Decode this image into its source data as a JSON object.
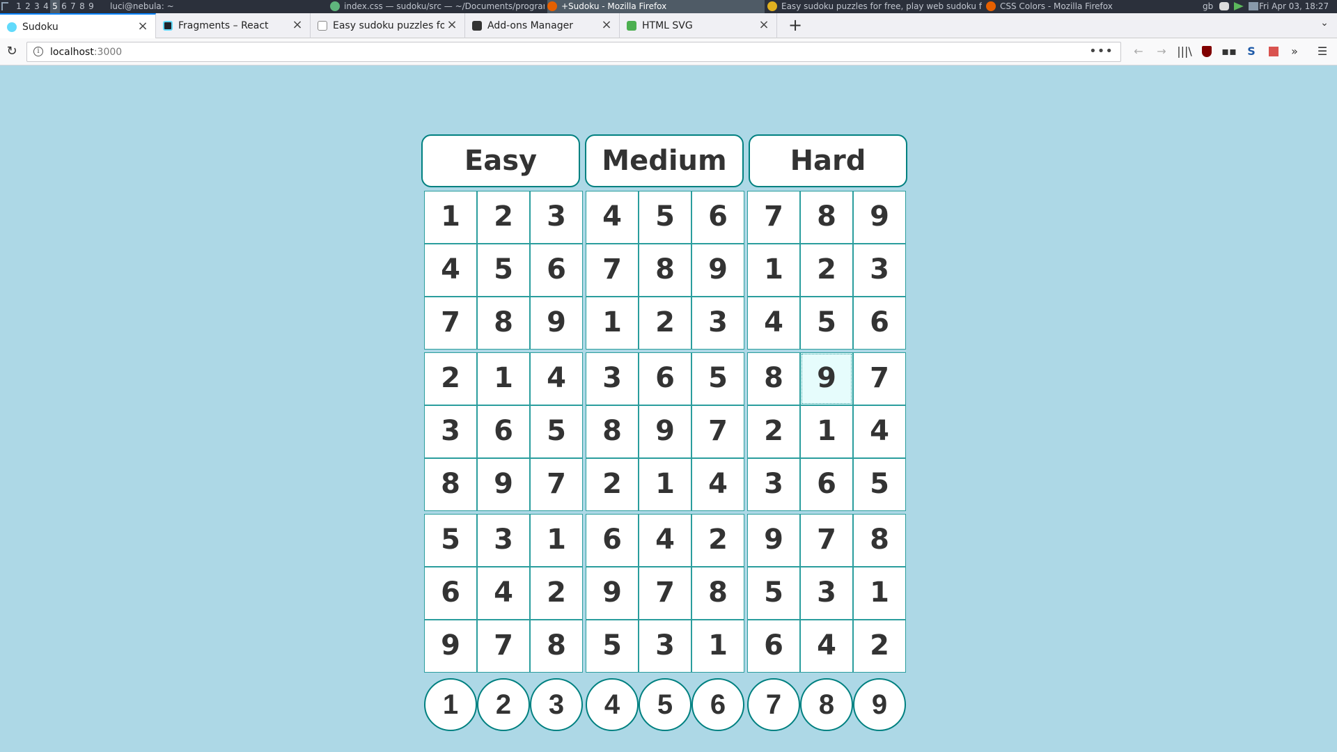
{
  "system_bar": {
    "workspaces": [
      "1",
      "2",
      "3",
      "4",
      "5",
      "6",
      "7",
      "8",
      "9"
    ],
    "active_workspace": "5",
    "windows": [
      {
        "title": "luci@nebula: ~",
        "icon": "terminal-icon",
        "active": false
      },
      {
        "title": "index.css — sudoku/src — ~/Documents/program...",
        "icon": "atom-icon",
        "active": false
      },
      {
        "title": "+Sudoku - Mozilla Firefox",
        "icon": "firefox-icon",
        "active": true
      },
      {
        "title": "Easy sudoku puzzles for free, play web sudoku fo...",
        "icon": "chrome-icon",
        "active": false
      },
      {
        "title": "CSS Colors - Mozilla Firefox",
        "icon": "firefox-icon",
        "active": false
      }
    ],
    "keyboard_layout": "gb",
    "clock": "Fri Apr 03, 18:27"
  },
  "tabs": [
    {
      "label": "Sudoku",
      "icon": "react-icon",
      "active": true
    },
    {
      "label": "Fragments – React",
      "icon": "react-icon",
      "active": false
    },
    {
      "label": "Easy sudoku puzzles for f",
      "icon": "grid-icon",
      "active": false
    },
    {
      "label": "Add-ons Manager",
      "icon": "puzzle-icon",
      "active": false
    },
    {
      "label": "HTML SVG",
      "icon": "w3schools-icon",
      "active": false
    }
  ],
  "url": {
    "host": "localhost",
    "port": ":3000"
  },
  "difficulty": {
    "easy": "Easy",
    "medium": "Medium",
    "hard": "Hard"
  },
  "board": {
    "selected_row": 3,
    "selected_col": 7,
    "rows": [
      [
        "1",
        "2",
        "3",
        "4",
        "5",
        "6",
        "7",
        "8",
        "9"
      ],
      [
        "4",
        "5",
        "6",
        "7",
        "8",
        "9",
        "1",
        "2",
        "3"
      ],
      [
        "7",
        "8",
        "9",
        "1",
        "2",
        "3",
        "4",
        "5",
        "6"
      ],
      [
        "2",
        "1",
        "4",
        "3",
        "6",
        "5",
        "8",
        "9",
        "7"
      ],
      [
        "3",
        "6",
        "5",
        "8",
        "9",
        "7",
        "2",
        "1",
        "4"
      ],
      [
        "8",
        "9",
        "7",
        "2",
        "1",
        "4",
        "3",
        "6",
        "5"
      ],
      [
        "5",
        "3",
        "1",
        "6",
        "4",
        "2",
        "9",
        "7",
        "8"
      ],
      [
        "6",
        "4",
        "2",
        "9",
        "7",
        "8",
        "5",
        "3",
        "1"
      ],
      [
        "9",
        "7",
        "8",
        "5",
        "3",
        "1",
        "6",
        "4",
        "2"
      ]
    ]
  },
  "numpad": [
    "1",
    "2",
    "3",
    "4",
    "5",
    "6",
    "7",
    "8",
    "9"
  ],
  "colors": {
    "background": "#add8e6",
    "accent": "#008080",
    "cell_border": "#2a9d9d",
    "selected_cell": "#e6fcfc"
  }
}
